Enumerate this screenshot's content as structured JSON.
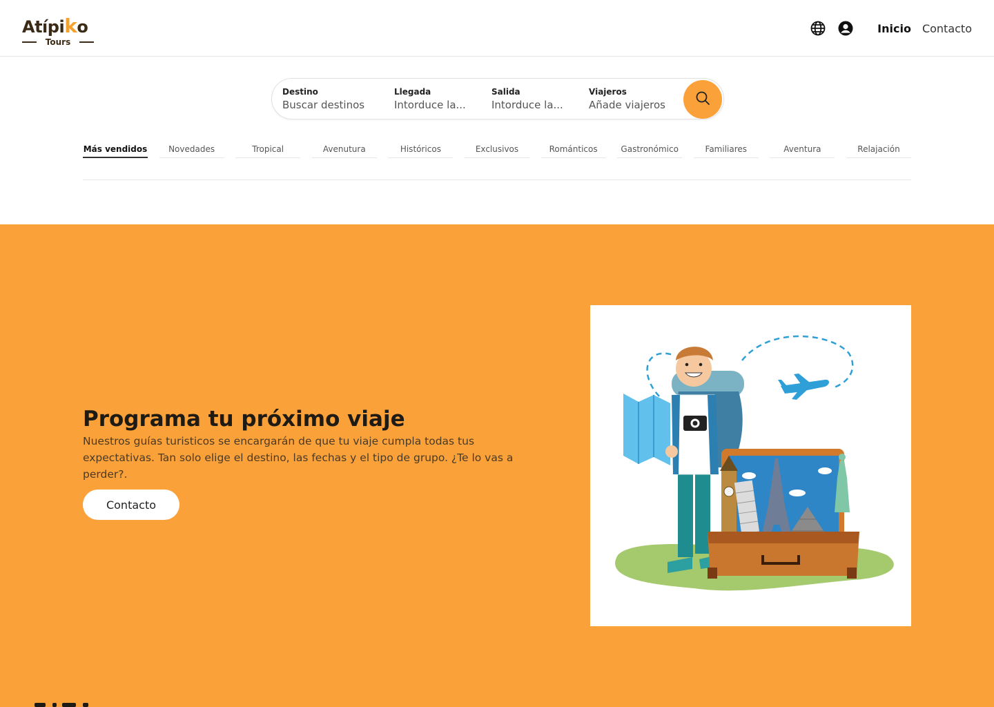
{
  "header": {
    "logo": {
      "name_prefix": "Atípi",
      "name_k": "k",
      "name_suffix": "o",
      "subtitle": "Tours"
    },
    "icons": [
      "globe-icon",
      "user-icon"
    ],
    "nav": {
      "home": "Inicio",
      "contact": "Contacto"
    }
  },
  "search": {
    "destination": {
      "label": "Destino",
      "placeholder": "Buscar destinos"
    },
    "arrival": {
      "label": "Llegada",
      "placeholder": "Intorduce la..."
    },
    "departure": {
      "label": "Salida",
      "placeholder": "Intorduce la..."
    },
    "travelers": {
      "label": "Viajeros",
      "placeholder": "Añade viajeros"
    },
    "button_icon": "search-icon"
  },
  "tabs": [
    "Más vendidos",
    "Novedades",
    "Tropical",
    "Avenutura",
    "Históricos",
    "Exclusivos",
    "Románticos",
    "Gastronómico",
    "Familiares",
    "Aventura",
    "Relajación"
  ],
  "active_tab": "Más vendidos",
  "hero": {
    "title": "Programa tu próximo viaje",
    "text": "Nuestros guías turisticos se encargarán de que tu viaje cumpla todas tus expectativas. Tan solo elige el destino, las fechas y el tipo de grupo. ¿Te lo vas a perder?.",
    "button": "Contacto",
    "illustration": "traveler-with-suitcase-illustration"
  },
  "colors": {
    "accent": "#fba13a",
    "logo_dark": "#3a2a16",
    "hero_text": "#4a3a24"
  }
}
